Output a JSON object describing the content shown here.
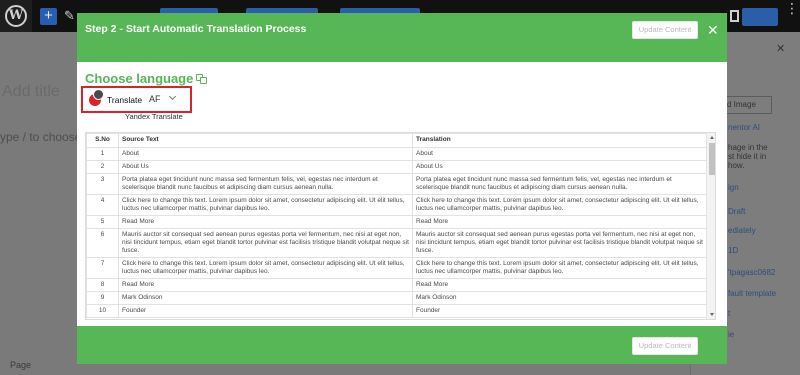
{
  "background": {
    "title_placeholder": "Add title",
    "block_hint": "ype / to choose",
    "footer_label": "Page",
    "sidebar_items": [
      "d Image",
      "nentor AI",
      "hage in the",
      "st hide it in",
      "how.",
      "ign",
      "Draft",
      "ediately",
      "1D",
      "'tpagasc0682",
      "fault template",
      "t",
      "ie"
    ],
    "sidebar_box_label": "d Image",
    "sidebar_close": "✕"
  },
  "modal": {
    "title": "Step 2 - Start Automatic Translation Process",
    "update_button_label": "Update Content",
    "close_label": "✕",
    "choose_language": "Choose language",
    "translate_label": "Translate",
    "language_value": "AF",
    "yandex_label": "Yandex Translate",
    "footer_update_button_label": "Update Content"
  },
  "table": {
    "headers": [
      "S.No",
      "Source Text",
      "Translation"
    ],
    "rows": [
      [
        "1",
        "About",
        "About"
      ],
      [
        "2",
        "About Us",
        "About Us"
      ],
      [
        "3",
        "Porta platea eget tincidunt nunc massa sed fermentum felis, vel, egestas nec interdum et scelerisque blandit nunc faucibus et adipiscing diam cursus aenean nulla.",
        "Porta platea eget tincidunt nunc massa sed fermentum felis, vel, egestas nec interdum et scelerisque blandit nunc faucibus et adipiscing diam cursus aenean nulla."
      ],
      [
        "4",
        "Click here to change this text. Lorem ipsum dolor sit amet, consectetur adipiscing elit. Ut elit tellus, luctus nec ullamcorper mattis, pulvinar dapibus leo.",
        "Click here to change this text. Lorem ipsum dolor sit amet, consectetur adipiscing elit. Ut elit tellus, luctus nec ullamcorper mattis, pulvinar dapibus leo."
      ],
      [
        "5",
        "Read More",
        "Read More"
      ],
      [
        "6",
        "Mauris auctor sit consequat sed aenean purus egestas porta vel fermentum, nec nisi at eget non, nisi tincidunt tempus, etiam eget blandit tortor pulvinar est facilisis tristique blandit volutpat neque sit fusce.",
        "Mauris auctor sit consequat sed aenean purus egestas porta vel fermentum, nec nisi at eget non, nisi tincidunt tempus, etiam eget blandit tortor pulvinar est facilisis tristique blandit volutpat neque sit fusce."
      ],
      [
        "7",
        "Click here to change this text. Lorem ipsum dolor sit amet, consectetur adipiscing elit. Ut elit tellus, luctus nec ullamcorper mattis, pulvinar dapibus leo.",
        "Click here to change this text. Lorem ipsum dolor sit amet, consectetur adipiscing elit. Ut elit tellus, luctus nec ullamcorper mattis, pulvinar dapibus leo."
      ],
      [
        "8",
        "Read More",
        "Read More"
      ],
      [
        "9",
        "Mark Odinson",
        "Mark Odinson"
      ],
      [
        "10",
        "Founder",
        "Founder"
      ]
    ]
  },
  "colors": {
    "accent_green": "#57b757",
    "highlight_red": "#d8232a"
  },
  "icons": {
    "choose_language_icon": "copy-icon",
    "translate_provider_icon": "yandex-translate-icon",
    "wp_logo": "wordpress-logo-icon",
    "dropdown": "chevron-down-icon"
  }
}
